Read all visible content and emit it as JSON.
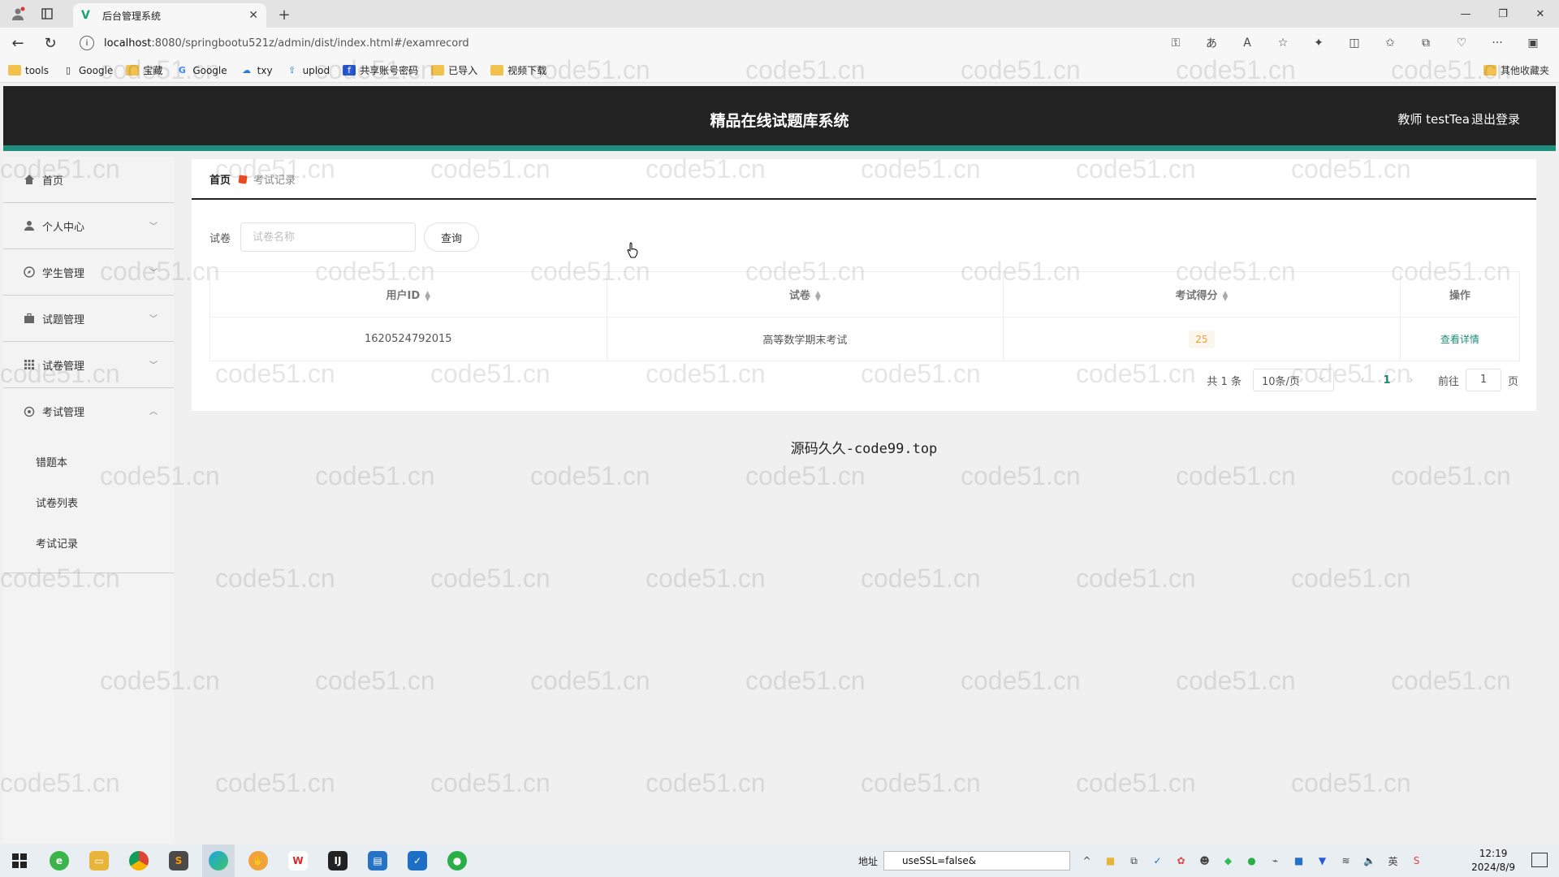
{
  "browser": {
    "tab_title": "后台管理系统",
    "url_host": "localhost",
    "url_path": ":8080/springbootu521z/admin/dist/index.html#/examrecord",
    "bookmarks": [
      "tools",
      "Google",
      "宝藏",
      "Google",
      "txy",
      "uplod",
      "共享账号密码",
      "已导入",
      "视频下载"
    ],
    "bookmarks_right": "其他收藏夹"
  },
  "header": {
    "title": "精品在线试题库系统",
    "user": "教师 testTea",
    "logout": "退出登录"
  },
  "sidebar": {
    "items": [
      {
        "label": "首页"
      },
      {
        "label": "个人中心"
      },
      {
        "label": "学生管理"
      },
      {
        "label": "试题管理"
      },
      {
        "label": "试卷管理"
      },
      {
        "label": "考试管理"
      }
    ],
    "sub_items": [
      "错题本",
      "试卷列表",
      "考试记录"
    ]
  },
  "breadcrumb": {
    "home": "首页",
    "current": "考试记录"
  },
  "search": {
    "label": "试卷",
    "placeholder": "试卷名称",
    "button": "查询"
  },
  "table": {
    "columns": [
      "用户ID",
      "试卷",
      "考试得分",
      "操作"
    ],
    "rows": [
      {
        "user_id": "1620524792015",
        "paper": "高等数学期末考试",
        "score": "25",
        "action": "查看详情"
      }
    ]
  },
  "pager": {
    "total": "共 1 条",
    "page_size": "10条/页",
    "current_page": "1",
    "goto_label": "前往",
    "goto_value": "1",
    "page_suffix": "页"
  },
  "footer_text": "源码久久-code99.top",
  "watermark": "code51.cn",
  "taskbar": {
    "address_label": "地址",
    "address_value": "useSSL=false&",
    "time": "12:19",
    "date": "2024/8/9",
    "ime": "英"
  }
}
